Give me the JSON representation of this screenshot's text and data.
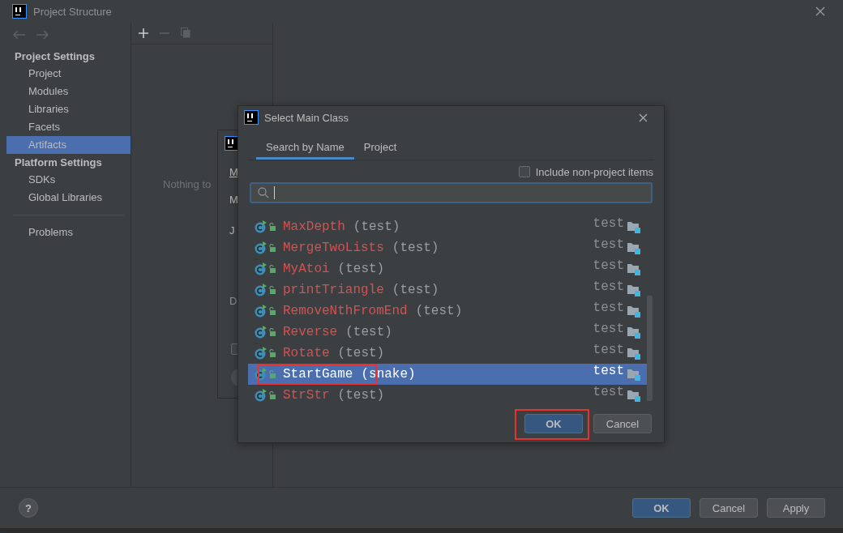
{
  "window": {
    "title": "Project Structure"
  },
  "sidebar": {
    "sections": [
      {
        "heading": "Project Settings",
        "items": [
          {
            "label": "Project",
            "selected": false
          },
          {
            "label": "Modules",
            "selected": false
          },
          {
            "label": "Libraries",
            "selected": false
          },
          {
            "label": "Facets",
            "selected": false
          },
          {
            "label": "Artifacts",
            "selected": true
          }
        ]
      },
      {
        "heading": "Platform Settings",
        "items": [
          {
            "label": "SDKs",
            "selected": false
          },
          {
            "label": "Global Libraries",
            "selected": false
          }
        ]
      },
      {
        "items": [
          {
            "label": "Problems",
            "selected": false
          }
        ]
      }
    ]
  },
  "middle_panel": {
    "empty_text": "Nothing to"
  },
  "back_dialog": {
    "labels": [
      {
        "text": "M",
        "underlined": true
      },
      {
        "text": "M",
        "underlined": false
      },
      {
        "text": "J",
        "underlined": false
      },
      {
        "text": "D",
        "underlined": false
      }
    ],
    "checked": false
  },
  "dialog": {
    "title": "Select Main Class",
    "tabs": [
      {
        "label": "Search by Name",
        "selected": true
      },
      {
        "label": "Project",
        "selected": false
      }
    ],
    "include_option": {
      "label": "Include non-project items",
      "checked": false
    },
    "rows": [
      {
        "name": "MaxDepth",
        "module": "(test)",
        "location": "test",
        "selected": false,
        "highlighted": false
      },
      {
        "name": "MergeTwoLists",
        "module": "(test)",
        "location": "test",
        "selected": false,
        "highlighted": false
      },
      {
        "name": "MyAtoi",
        "module": "(test)",
        "location": "test",
        "selected": false,
        "highlighted": false
      },
      {
        "name": "printTriangle",
        "module": "(test)",
        "location": "test",
        "selected": false,
        "highlighted": false
      },
      {
        "name": "RemoveNthFromEnd",
        "module": "(test)",
        "location": "test",
        "selected": false,
        "highlighted": false
      },
      {
        "name": "Reverse",
        "module": "(test)",
        "location": "test",
        "selected": false,
        "highlighted": false
      },
      {
        "name": "Rotate",
        "module": "(test)",
        "location": "test",
        "selected": false,
        "highlighted": false
      },
      {
        "name": "StartGame",
        "module": "(snake)",
        "location": "test",
        "selected": true,
        "highlighted": true
      },
      {
        "name": "StrStr",
        "module": "(test)",
        "location": "test",
        "selected": false,
        "highlighted": false
      }
    ],
    "buttons": [
      {
        "label": "OK",
        "primary": true,
        "highlighted": true
      },
      {
        "label": "Cancel",
        "primary": false,
        "highlighted": false
      }
    ]
  },
  "footer": {
    "help": "?",
    "buttons": [
      {
        "label": "OK",
        "primary": true
      },
      {
        "label": "Cancel",
        "primary": false
      },
      {
        "label": "Apply",
        "primary": false
      }
    ]
  }
}
